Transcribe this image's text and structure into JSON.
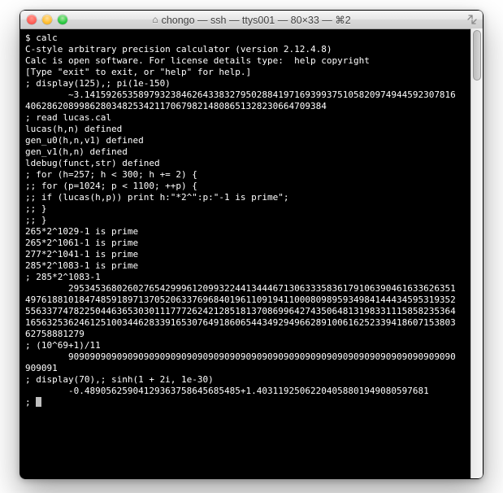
{
  "window": {
    "title": "chongo — ssh — ttys001 — 80×33 — ⌘2"
  },
  "terminal": {
    "lines": [
      "$ calc",
      "C-style arbitrary precision calculator (version 2.12.4.8)",
      "Calc is open software. For license details type:  help copyright",
      "[Type \"exit\" to exit, or \"help\" for help.]",
      "",
      "; display(125),; pi(1e-150)",
      "        ~3.14159265358979323846264338327950288419716939937510582097494459230781640628620899862803482534211706798214808651328230664709384",
      "; read lucas.cal",
      "lucas(h,n) defined",
      "gen_u0(h,n,v1) defined",
      "gen_v1(h,n) defined",
      "ldebug(funct,str) defined",
      "; for (h=257; h < 300; h += 2) {",
      ";; for (p=1024; p < 1100; ++p) {",
      ";; if (lucas(h,p)) print h:\"*2^\":p:\"-1 is prime\";",
      ";; }",
      ";; }",
      "265*2^1029-1 is prime",
      "265*2^1061-1 is prime",
      "277*2^1041-1 is prime",
      "285*2^1083-1 is prime",
      "; 285*2^1083-1",
      "        29534536802602765429996120993224413444671306333583617910639046163362635149761881018474859189713705206337696840196110919411000809895934984144434595319352556337747822504463653030111777262421285181370869964274350648131983311158582353641656325362461251003446283391653076491860654434929496628910061625233941860715380362758881279",
      "; (10^69+1)/11",
      "        909090909090909090909090909090909090909090909090909090909090909090909090909091",
      "; display(70),; sinh(1 + 2i, 1e-30)",
      "        -0.48905625904129363758645685485+1.40311925062204058801949080597681",
      "; "
    ]
  }
}
